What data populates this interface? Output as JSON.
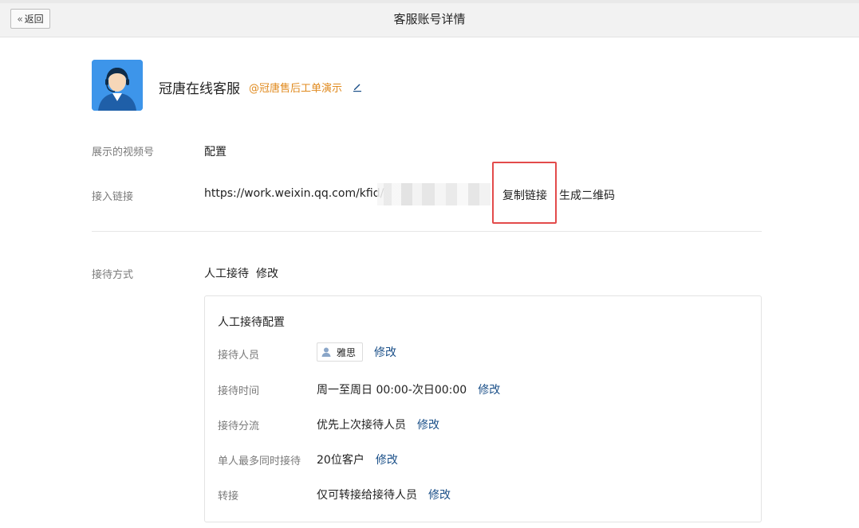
{
  "header": {
    "back_label": "返回",
    "title": "客服账号详情"
  },
  "account": {
    "name": "冠唐在线客服",
    "tag": "@冠唐售后工单演示"
  },
  "rows": {
    "video_label": "展示的视频号",
    "video_action": "配置",
    "link_label": "接入链接",
    "link_value": "https://work.weixin.qq.com/kfid/",
    "copy_link": "复制链接",
    "qrcode": "生成二维码",
    "reception_label": "接待方式",
    "reception_value": "人工接待",
    "reception_edit": "修改"
  },
  "config": {
    "title": "人工接待配置",
    "items": [
      {
        "label": "接待人员",
        "value": "雅思",
        "action": "修改"
      },
      {
        "label": "接待时间",
        "value": "周一至周日 00:00-次日00:00",
        "action": "修改"
      },
      {
        "label": "接待分流",
        "value": "优先上次接待人员",
        "action": "修改"
      },
      {
        "label": "单人最多同时接待",
        "value": "20位客户",
        "action": "修改"
      },
      {
        "label": "转接",
        "value": "仅可转接给接待人员",
        "action": "修改"
      }
    ]
  },
  "colors": {
    "link": "#1a4f88",
    "tag": "#e08a1e",
    "avatar_bg": "#3d95ea",
    "highlight": "#e34b4b"
  },
  "icons": {
    "back": "double-chevron-left-icon",
    "edit": "pencil-icon",
    "member": "person-icon",
    "avatar": "headset-agent-avatar"
  }
}
